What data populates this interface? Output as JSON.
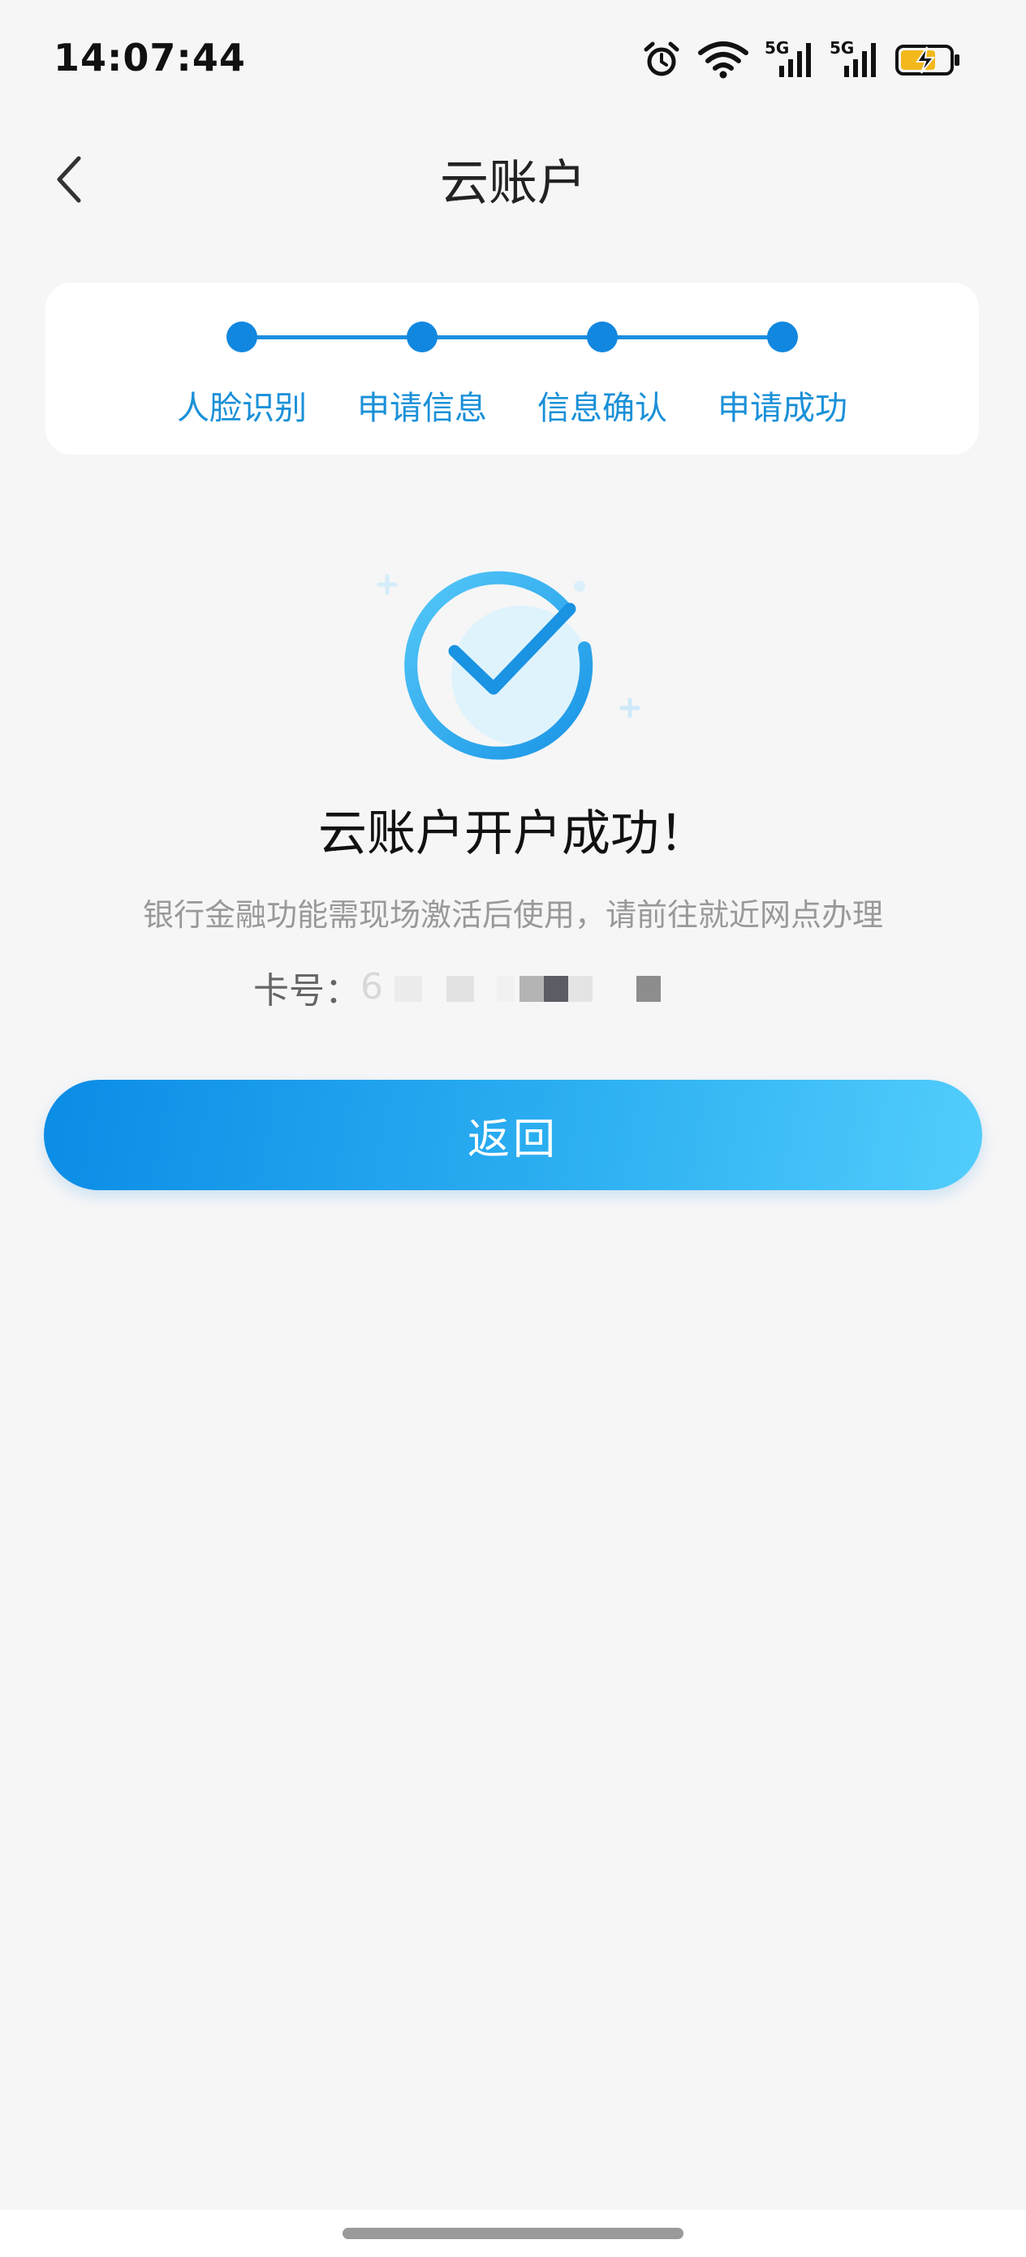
{
  "status_bar": {
    "time": "14:07:44",
    "network_1": "5G",
    "network_2": "5G",
    "icons": [
      "alarm-icon",
      "wifi-icon",
      "signal-5g-icon",
      "signal-5g-icon",
      "battery-charging-icon"
    ]
  },
  "nav": {
    "title": "云账户",
    "back_icon": "chevron-left-icon"
  },
  "steps": {
    "items": [
      {
        "label": "人脸识别"
      },
      {
        "label": "申请信息"
      },
      {
        "label": "信息确认"
      },
      {
        "label": "申请成功"
      }
    ],
    "active_color": "#1187e0"
  },
  "result": {
    "icon": "success-check-icon",
    "title": "云账户开户成功！",
    "description": "银行金融功能需现场激活后使用，请前往就近网点办理",
    "card_label": "卡号：",
    "card_number_visible": "6"
  },
  "actions": {
    "return_label": "返回"
  },
  "colors": {
    "accent": "#1187e0",
    "background": "#f6f6f7",
    "button_gradient_start": "#0b8ce6",
    "button_gradient_end": "#52cdfc"
  }
}
